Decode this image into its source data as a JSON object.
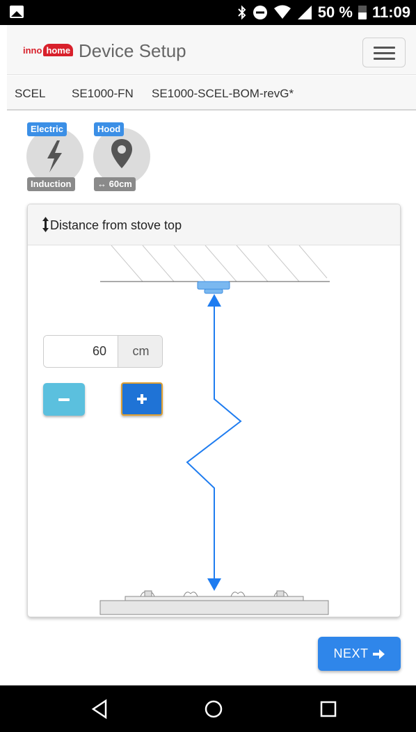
{
  "status_bar": {
    "battery_text": "50 %",
    "time": "11:09",
    "icons": [
      "gallery-icon",
      "bluetooth-icon",
      "do-not-disturb-icon",
      "wifi-icon",
      "signal-icon",
      "battery-icon"
    ]
  },
  "header": {
    "logo_inno": "inno",
    "logo_home": "home",
    "title": "Device Setup",
    "menu_icon": "hamburger-icon"
  },
  "subbar": {
    "items": [
      "SCEL",
      "SE1000-FN",
      "SE1000-SCEL-BOM-revG*"
    ]
  },
  "config": {
    "stove": {
      "top_label": "Electric",
      "bottom_label": "Induction",
      "icon": "lightning-icon"
    },
    "location": {
      "top_label": "Hood",
      "bottom_label": "↔ 60cm",
      "icon": "map-pin-icon"
    }
  },
  "card": {
    "title": "Distance from stove top",
    "title_icon": "vertical-arrows-icon",
    "distance_value": "60",
    "unit": "cm"
  },
  "buttons": {
    "next_label": "NEXT"
  },
  "colors": {
    "brand_red": "#d8202b",
    "badge_blue": "#3b8fe6",
    "primary_blue": "#2f86ea",
    "info_blue": "#5bc0de",
    "diagram_blue": "#1e7cf0"
  },
  "nav_bar": {
    "icons": [
      "back-triangle-icon",
      "home-circle-icon",
      "recents-square-icon"
    ]
  }
}
